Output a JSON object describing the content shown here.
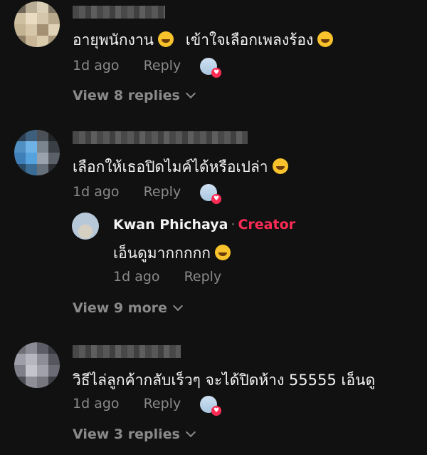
{
  "comments": [
    {
      "text": "อายุพนักงาน",
      "text2": "เข้าใจเลือกเพลงร้อง",
      "time": "1d ago",
      "reply": "Reply",
      "view": "View 8 replies"
    },
    {
      "text": "เลือกให้เธอปิดไมค์ได้หรือเปล่า",
      "time": "1d ago",
      "reply": "Reply",
      "view": "View 9 more"
    },
    {
      "text": "วิธีไล่ลูกค้ากลับเร็วๆ จะได้ปิดห้าง 55555 เอ็นดู",
      "time": "1d ago",
      "reply": "Reply",
      "view": "View 3 replies"
    }
  ],
  "creator_reply": {
    "name": "Kwan Phichaya",
    "separator": "·",
    "badge": "Creator",
    "text": "เอ็นดูมากกกกก",
    "time": "1d ago",
    "reply": "Reply"
  },
  "colors": {
    "background": "#111111",
    "creator": "#fe2c55",
    "muted": "#8a8a8a"
  }
}
